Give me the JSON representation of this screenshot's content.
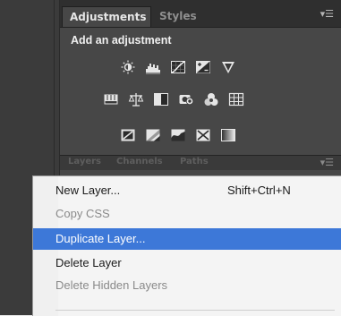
{
  "panel": {
    "tabs": [
      {
        "label": "Adjustments",
        "active": true
      },
      {
        "label": "Styles",
        "active": false
      }
    ],
    "menu_icon": "panel-menu-icon",
    "heading": "Add an adjustment",
    "adjustment_icons": [
      [
        "brightness-contrast-icon",
        "levels-icon",
        "curves-icon",
        "exposure-icon",
        "vibrance-icon"
      ],
      [
        "hue-saturation-icon",
        "color-balance-icon",
        "black-white-icon",
        "photo-filter-icon",
        "channel-mixer-icon",
        "color-lookup-icon"
      ],
      [
        "invert-icon",
        "posterize-icon",
        "threshold-icon",
        "gradient-map-icon",
        "selective-color-icon"
      ]
    ]
  },
  "lower_panel_tabs": [
    "Layers",
    "Channels",
    "Paths"
  ],
  "context_menu": {
    "items": [
      {
        "label": "New Layer...",
        "shortcut": "Shift+Ctrl+N",
        "state": "normal"
      },
      {
        "label": "Copy CSS",
        "shortcut": "",
        "state": "disabled"
      },
      {
        "label": "Duplicate Layer...",
        "shortcut": "",
        "state": "highlighted"
      },
      {
        "label": "Delete Layer",
        "shortcut": "",
        "state": "normal"
      },
      {
        "label": "Delete Hidden Layers",
        "shortcut": "",
        "state": "disabled"
      }
    ]
  },
  "colors": {
    "highlight": "#3d78d8",
    "panel_bg": "#474747",
    "tabbar_bg": "#2f2f2f",
    "menu_bg": "#f4f4f4"
  }
}
